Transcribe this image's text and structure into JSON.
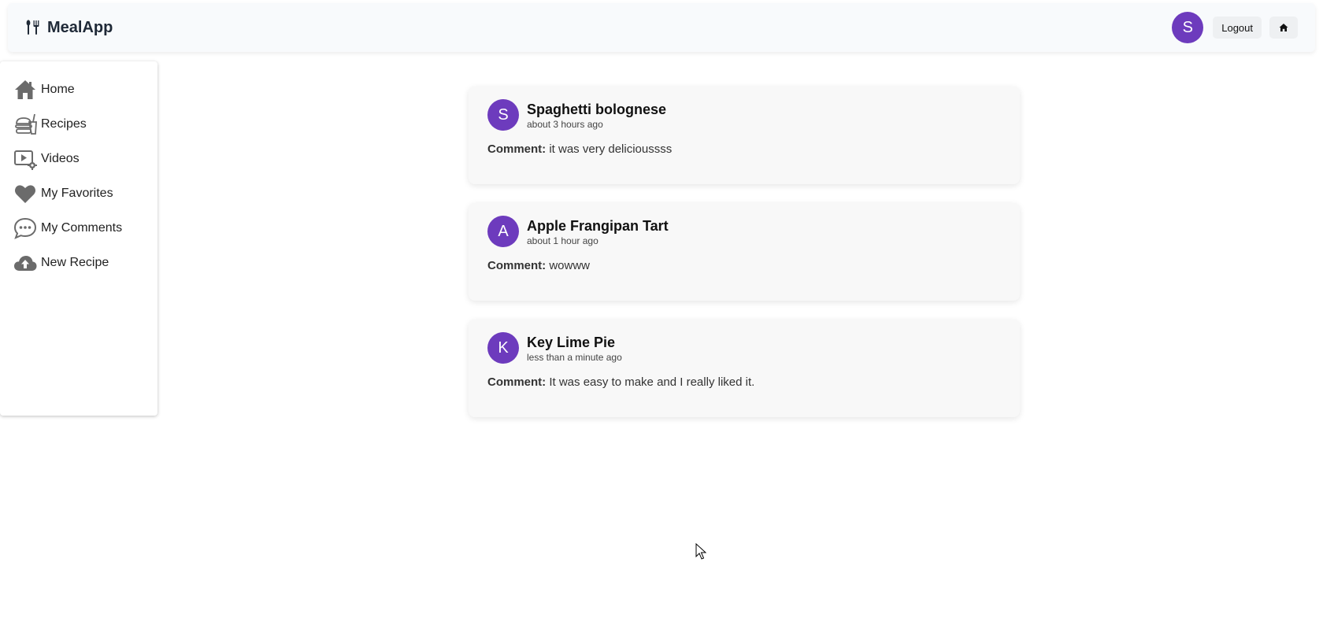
{
  "header": {
    "brand": "MealApp",
    "user_initial": "S",
    "logout_label": "Logout"
  },
  "sidebar": {
    "items": [
      {
        "label": "Home",
        "icon": "home-icon"
      },
      {
        "label": "Recipes",
        "icon": "recipes-icon"
      },
      {
        "label": "Videos",
        "icon": "videos-icon"
      },
      {
        "label": "My Favorites",
        "icon": "heart-icon"
      },
      {
        "label": "My Comments",
        "icon": "chat-bubble-icon"
      },
      {
        "label": "New Recipe",
        "icon": "cloud-upload-icon"
      }
    ]
  },
  "comments": [
    {
      "initial": "S",
      "recipe": "Spaghetti bolognese",
      "time": "about 3 hours ago",
      "label": "Comment:",
      "text": "it was very delicioussss"
    },
    {
      "initial": "A",
      "recipe": "Apple Frangipan Tart",
      "time": "about 1 hour ago",
      "label": "Comment:",
      "text": "wowww"
    },
    {
      "initial": "K",
      "recipe": "Key Lime Pie",
      "time": "less than a minute ago",
      "label": "Comment:",
      "text": "It was easy to make and I really liked it."
    }
  ],
  "colors": {
    "accent": "#6d3bbd",
    "icon_gray": "#6b6b6b",
    "card_bg": "#f8f8f8"
  }
}
